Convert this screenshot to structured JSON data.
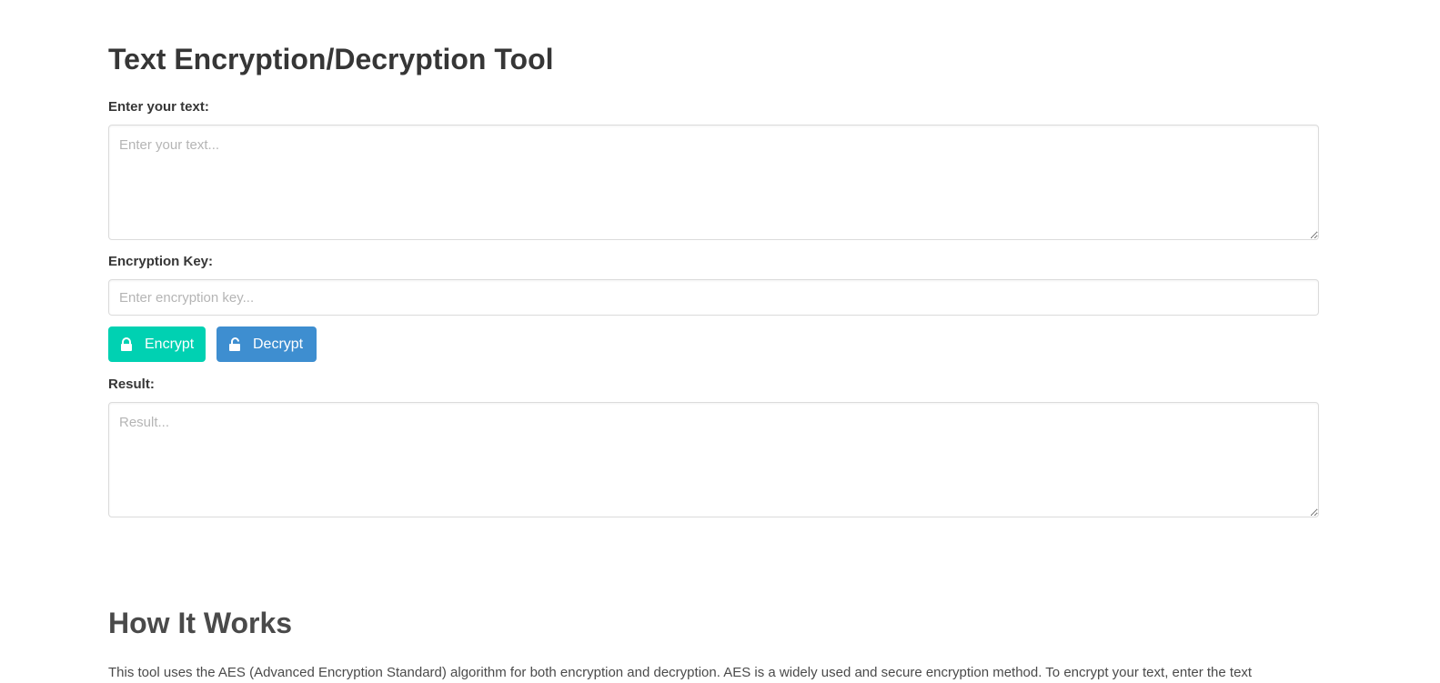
{
  "page": {
    "title": "Text Encryption/Decryption Tool"
  },
  "form": {
    "text_label": "Enter your text:",
    "text_placeholder": "Enter your text...",
    "key_label": "Encryption Key:",
    "key_placeholder": "Enter encryption key...",
    "result_label": "Result:",
    "result_placeholder": "Result..."
  },
  "buttons": {
    "encrypt_label": "Encrypt",
    "encrypt_icon": "lock-icon",
    "decrypt_label": "Decrypt",
    "decrypt_icon": "unlock-icon"
  },
  "how_it_works": {
    "heading": "How It Works",
    "body": "This tool uses the AES (Advanced Encryption Standard) algorithm for both encryption and decryption. AES is a widely used and secure encryption method. To encrypt your text, enter the text"
  },
  "colors": {
    "encrypt_button": "#00d1b2",
    "decrypt_button": "#3e8ed0",
    "text": "#363636",
    "border": "#dbdbdb",
    "placeholder": "#b5b5b5"
  }
}
